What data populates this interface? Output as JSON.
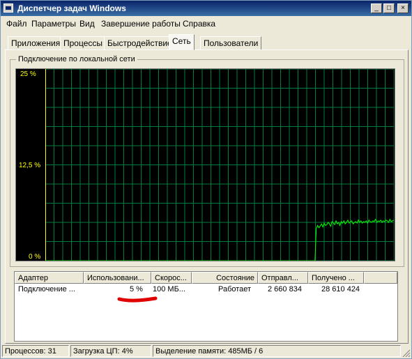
{
  "window": {
    "title": "Диспетчер задач Windows",
    "controls": {
      "minimize": "_",
      "maximize": "□",
      "close": "×"
    }
  },
  "menu": [
    "Файл",
    "Параметры",
    "Вид",
    "Завершение работы",
    "Справка"
  ],
  "tabs": [
    {
      "label": "Приложения",
      "active": false
    },
    {
      "label": "Процессы",
      "active": false
    },
    {
      "label": "Быстродействие",
      "active": false
    },
    {
      "label": "Сеть",
      "active": true
    },
    {
      "label": "Пользователи",
      "active": false
    }
  ],
  "graph": {
    "title": "Подключение по локальной сети",
    "y_labels": {
      "top": "25 %",
      "mid": "12,5 %",
      "bottom": "0 %"
    },
    "colors": {
      "grid": "#008040",
      "line": "#00ff00",
      "axis": "#ffff00",
      "bg": "#000000"
    }
  },
  "chart_data": {
    "type": "line",
    "ylim": [
      0,
      25
    ],
    "series": [
      {
        "values": [
          0,
          0,
          0,
          0,
          0,
          0,
          0,
          0,
          0,
          0,
          0,
          0,
          0,
          0,
          0,
          0,
          0,
          0,
          0,
          0,
          0,
          0,
          0,
          0,
          0,
          0,
          0,
          0,
          0,
          0,
          0,
          0,
          0,
          0,
          0,
          0,
          0,
          0,
          0,
          0,
          0,
          0,
          0,
          0,
          0,
          0,
          0,
          0,
          0,
          0,
          0,
          0,
          0,
          0,
          0,
          0,
          0,
          0,
          0,
          0,
          0,
          0,
          0,
          0,
          0,
          0,
          0,
          0,
          0,
          0,
          0,
          0,
          0,
          0,
          0,
          0,
          0,
          0,
          0,
          0,
          0,
          0,
          0,
          0,
          0,
          0,
          0,
          0,
          0,
          0,
          0,
          0,
          0,
          0,
          0,
          0,
          0,
          0,
          0,
          0,
          0,
          0,
          0,
          0,
          0,
          0,
          0,
          0,
          0,
          0,
          0,
          0,
          0,
          0,
          0,
          0,
          0,
          0,
          0,
          0,
          0,
          0,
          0,
          0,
          0,
          0,
          0,
          0,
          0,
          0,
          0,
          0,
          0,
          0,
          0,
          0,
          0,
          0,
          0,
          0,
          0,
          0,
          0,
          0,
          0,
          0,
          0,
          0,
          0,
          0,
          0,
          0,
          0,
          0,
          0,
          0,
          0,
          0,
          0,
          0,
          0,
          0,
          0,
          0,
          0,
          0,
          0,
          0,
          0,
          0,
          0,
          0,
          0,
          0,
          0,
          0,
          0,
          0,
          0,
          0,
          0,
          0,
          0,
          0,
          0,
          0,
          0,
          0,
          0,
          0,
          0,
          0,
          0,
          0,
          0,
          0,
          0,
          0,
          0,
          0,
          0,
          0,
          0,
          0,
          0,
          0,
          4.2,
          4.6,
          4.3,
          4.5,
          4.8,
          4.4,
          4.9,
          4.6,
          4.7,
          5.0,
          4.8,
          4.5,
          5.1,
          4.9,
          4.7,
          5.2,
          4.8,
          5.0,
          4.6,
          5.1,
          4.9,
          5.2,
          4.8,
          5.0,
          5.3,
          4.9,
          5.1,
          5.2,
          4.8,
          5.0,
          5.1,
          4.9,
          5.3,
          5.0,
          5.2,
          4.9,
          5.1,
          5.0,
          5.2,
          4.9,
          5.3,
          5.1,
          5.0,
          5.2,
          5.1,
          5.4,
          5.0,
          5.2,
          5.1,
          5.3,
          5.0,
          5.2,
          5.1,
          5.3,
          5.2,
          5.0,
          5.4,
          5.1,
          5.2,
          5.3
        ]
      }
    ]
  },
  "adapters": {
    "columns": [
      "Адаптер",
      "Использовани...",
      "Скорос...",
      "Состояние",
      "Отправл...",
      "Получено ..."
    ],
    "rows": [
      [
        "Подключение ...",
        "5 %",
        "100 МБ...",
        "Работает",
        "2 660 834",
        "28 610 424"
      ]
    ],
    "annotation_color": "#e00000"
  },
  "status": {
    "processes": "Процессов: 31",
    "cpu": "Загрузка ЦП: 4%",
    "memory": "Выделение памяти: 485МБ / 6"
  }
}
